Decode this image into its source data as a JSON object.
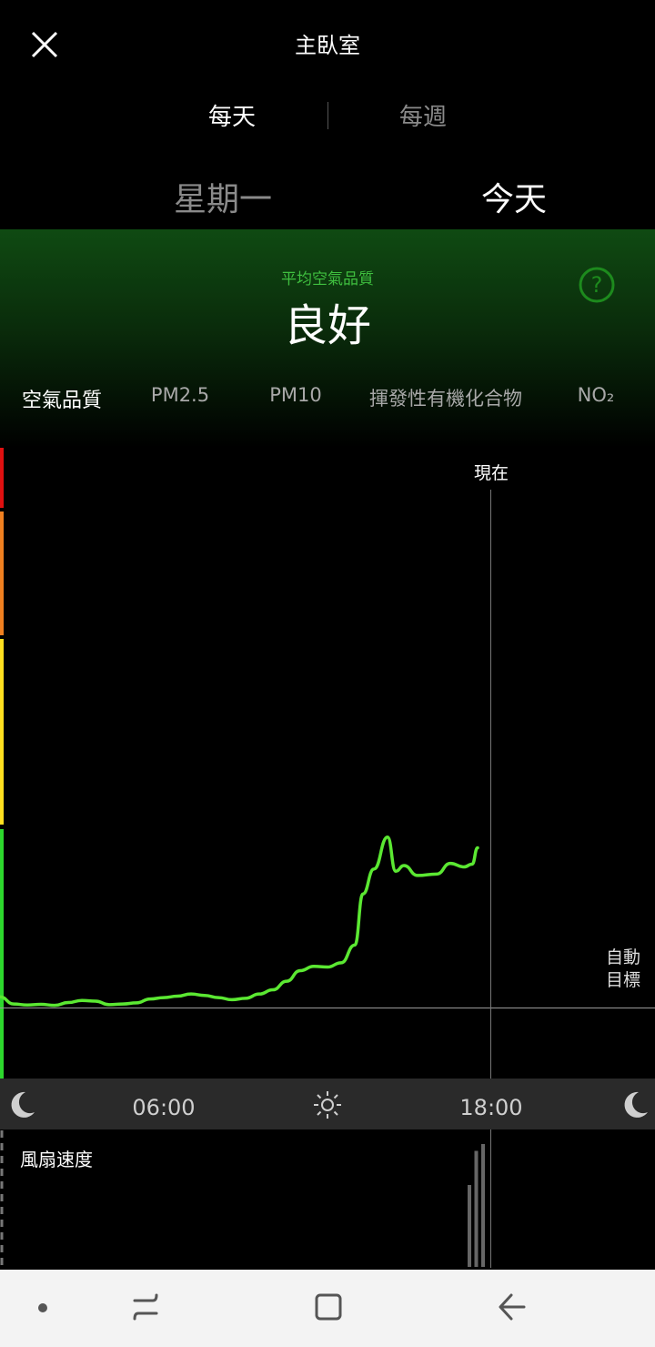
{
  "header": {
    "title": "主臥室",
    "close_icon": "close-icon"
  },
  "period_tabs": {
    "daily": "每天",
    "weekly": "每週",
    "selected": "每天"
  },
  "day_nav": {
    "previous": "星期一",
    "current": "今天"
  },
  "summary": {
    "label": "平均空氣品質",
    "value": "良好",
    "accent_color": "#3fbf3f",
    "help_icon": "question-circle-icon"
  },
  "metric_tabs": {
    "items": [
      "空氣品質",
      "PM2.5",
      "PM10",
      "揮發性有機化合物",
      "NO₂"
    ],
    "selected": "空氣品質"
  },
  "chart_data": {
    "type": "line",
    "now_label": "現在",
    "target_label_line1": "自動",
    "target_label_line2": "目標",
    "x_ticks": [
      "06:00",
      "18:00"
    ],
    "x_range_hours": [
      0,
      24
    ],
    "now_hour": 18,
    "series_color": "#5be832",
    "scale_colors": [
      "#e01010",
      "#f08020",
      "#ffe020",
      "#2dd82d"
    ],
    "series": [
      {
        "points": [
          [
            0.0,
            1.5
          ],
          [
            0.5,
            0.5
          ],
          [
            1.0,
            0.35
          ],
          [
            1.5,
            0.45
          ],
          [
            2.0,
            0.3
          ],
          [
            2.5,
            0.7
          ],
          [
            3.0,
            1.0
          ],
          [
            3.5,
            0.9
          ],
          [
            4.0,
            0.4
          ],
          [
            4.5,
            0.5
          ],
          [
            5.0,
            0.65
          ],
          [
            5.5,
            1.2
          ],
          [
            6.0,
            1.4
          ],
          [
            6.5,
            1.6
          ],
          [
            7.0,
            1.9
          ],
          [
            7.5,
            1.7
          ],
          [
            8.0,
            1.4
          ],
          [
            8.5,
            1.1
          ],
          [
            9.0,
            1.3
          ],
          [
            9.5,
            1.9
          ],
          [
            10.0,
            2.5
          ],
          [
            10.5,
            3.7
          ],
          [
            11.0,
            5.2
          ],
          [
            11.5,
            5.8
          ],
          [
            12.0,
            5.7
          ],
          [
            12.5,
            6.3
          ],
          [
            13.0,
            8.8
          ],
          [
            13.3,
            16.0
          ],
          [
            13.7,
            19.5
          ],
          [
            14.2,
            24.0
          ],
          [
            14.5,
            19.2
          ],
          [
            14.8,
            20.0
          ],
          [
            15.3,
            18.6
          ],
          [
            16.0,
            18.8
          ],
          [
            16.5,
            20.3
          ],
          [
            17.0,
            19.8
          ],
          [
            17.3,
            20.2
          ],
          [
            17.5,
            22.5
          ]
        ]
      }
    ],
    "y_target": 0,
    "y_range": [
      -3,
      40
    ]
  },
  "fan": {
    "label": "風扇速度",
    "bars_hours": [
      17.2,
      17.45,
      17.7
    ],
    "bars_level": [
      0.6,
      0.85,
      0.9
    ]
  },
  "navbar": {
    "recent_icon": "recent-apps-icon",
    "home_icon": "home-icon",
    "back_icon": "back-arrow-icon"
  }
}
